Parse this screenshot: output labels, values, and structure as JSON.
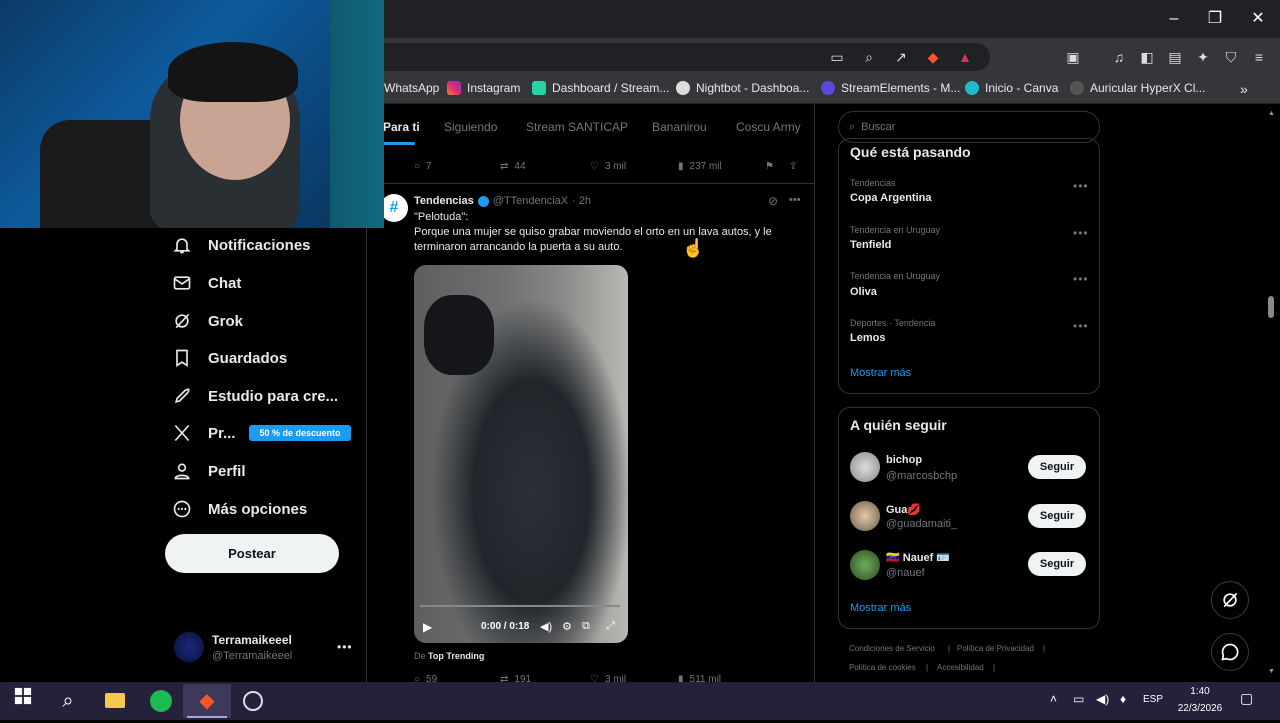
{
  "browser": {
    "bookmarks": [
      "WhatsApp",
      "Instagram",
      "Dashboard / Stream...",
      "Nightbot - Dashboa...",
      "StreamElements - M...",
      "Inicio - Canva",
      "Auricular HyperX Cl..."
    ]
  },
  "sidebar": {
    "items": [
      {
        "label": "Notificaciones",
        "icon": "bell-icon"
      },
      {
        "label": "Chat",
        "icon": "envelope-icon"
      },
      {
        "label": "Grok",
        "icon": "grok-icon"
      },
      {
        "label": "Guardados",
        "icon": "bookmark-icon"
      },
      {
        "label": "Estudio para cre...",
        "icon": "rocket-icon"
      },
      {
        "label": "Pr...",
        "icon": "x-logo-icon"
      },
      {
        "label": "Perfil",
        "icon": "person-icon"
      },
      {
        "label": "Más opciones",
        "icon": "more-circle-icon"
      }
    ],
    "discount_badge": "50 % de descuento",
    "post_button": "Postear",
    "account": {
      "name": "Terramaikeeel",
      "handle": "@Terramaikeeel"
    }
  },
  "feed": {
    "tabs": [
      "Para ti",
      "Siguiendo",
      "Stream SANTICAP",
      "Bananirou",
      "Coscu Army"
    ],
    "prev_tweet_actions": {
      "replies": "7",
      "retweets": "44",
      "likes": "3 mil",
      "views": "237 mil"
    },
    "tweet": {
      "author": "Tendencias",
      "handle": "@TTendenciaX",
      "time": "· 2h",
      "text_line1": "\"Pelotuda\":",
      "text_line2": "Porque una mujer se quiso grabar moviendo el orto en un lava autos, y le terminaron arrancando la puerta a su auto.",
      "video_time": "0:00 / 0:18",
      "video_progress": 0,
      "source_prefix": "De",
      "source": "Top Trending",
      "actions": {
        "replies": "59",
        "retweets": "191",
        "likes": "3 mil",
        "views": "511 mil"
      }
    }
  },
  "right": {
    "search_placeholder": "Buscar",
    "trends_title": "Qué está pasando",
    "trends": [
      {
        "category": "Tendencias",
        "name": "Copa Argentina"
      },
      {
        "category": "Tendencia en Uruguay",
        "name": "Tenfield"
      },
      {
        "category": "Tendencia en Uruguay",
        "name": "Oliva"
      },
      {
        "category": "Deportes · Tendencia",
        "name": "Lemos"
      }
    ],
    "show_more": "Mostrar más",
    "follow_title": "A quién seguir",
    "follow": [
      {
        "name": "bichop",
        "handle": "@marcosbchp",
        "button": "Seguir"
      },
      {
        "name": "Gua💋",
        "handle": "@guadamaiti_",
        "button": "Seguir"
      },
      {
        "name": "🇻🇪 Nauef 🪪",
        "handle": "@nauef",
        "button": "Seguir"
      }
    ],
    "show_more_2": "Mostrar más",
    "footer": [
      "Condiciones de Servicio",
      "|",
      "Política de Privacidad",
      "|",
      "Política de cookies",
      "|",
      "Accesibilidad",
      "|"
    ]
  },
  "taskbar": {
    "lang": "ESP",
    "time": "1:40",
    "date": "22/3/2026"
  },
  "colors": {
    "accent": "#1d9bf0",
    "taskbar": "#25213a"
  }
}
